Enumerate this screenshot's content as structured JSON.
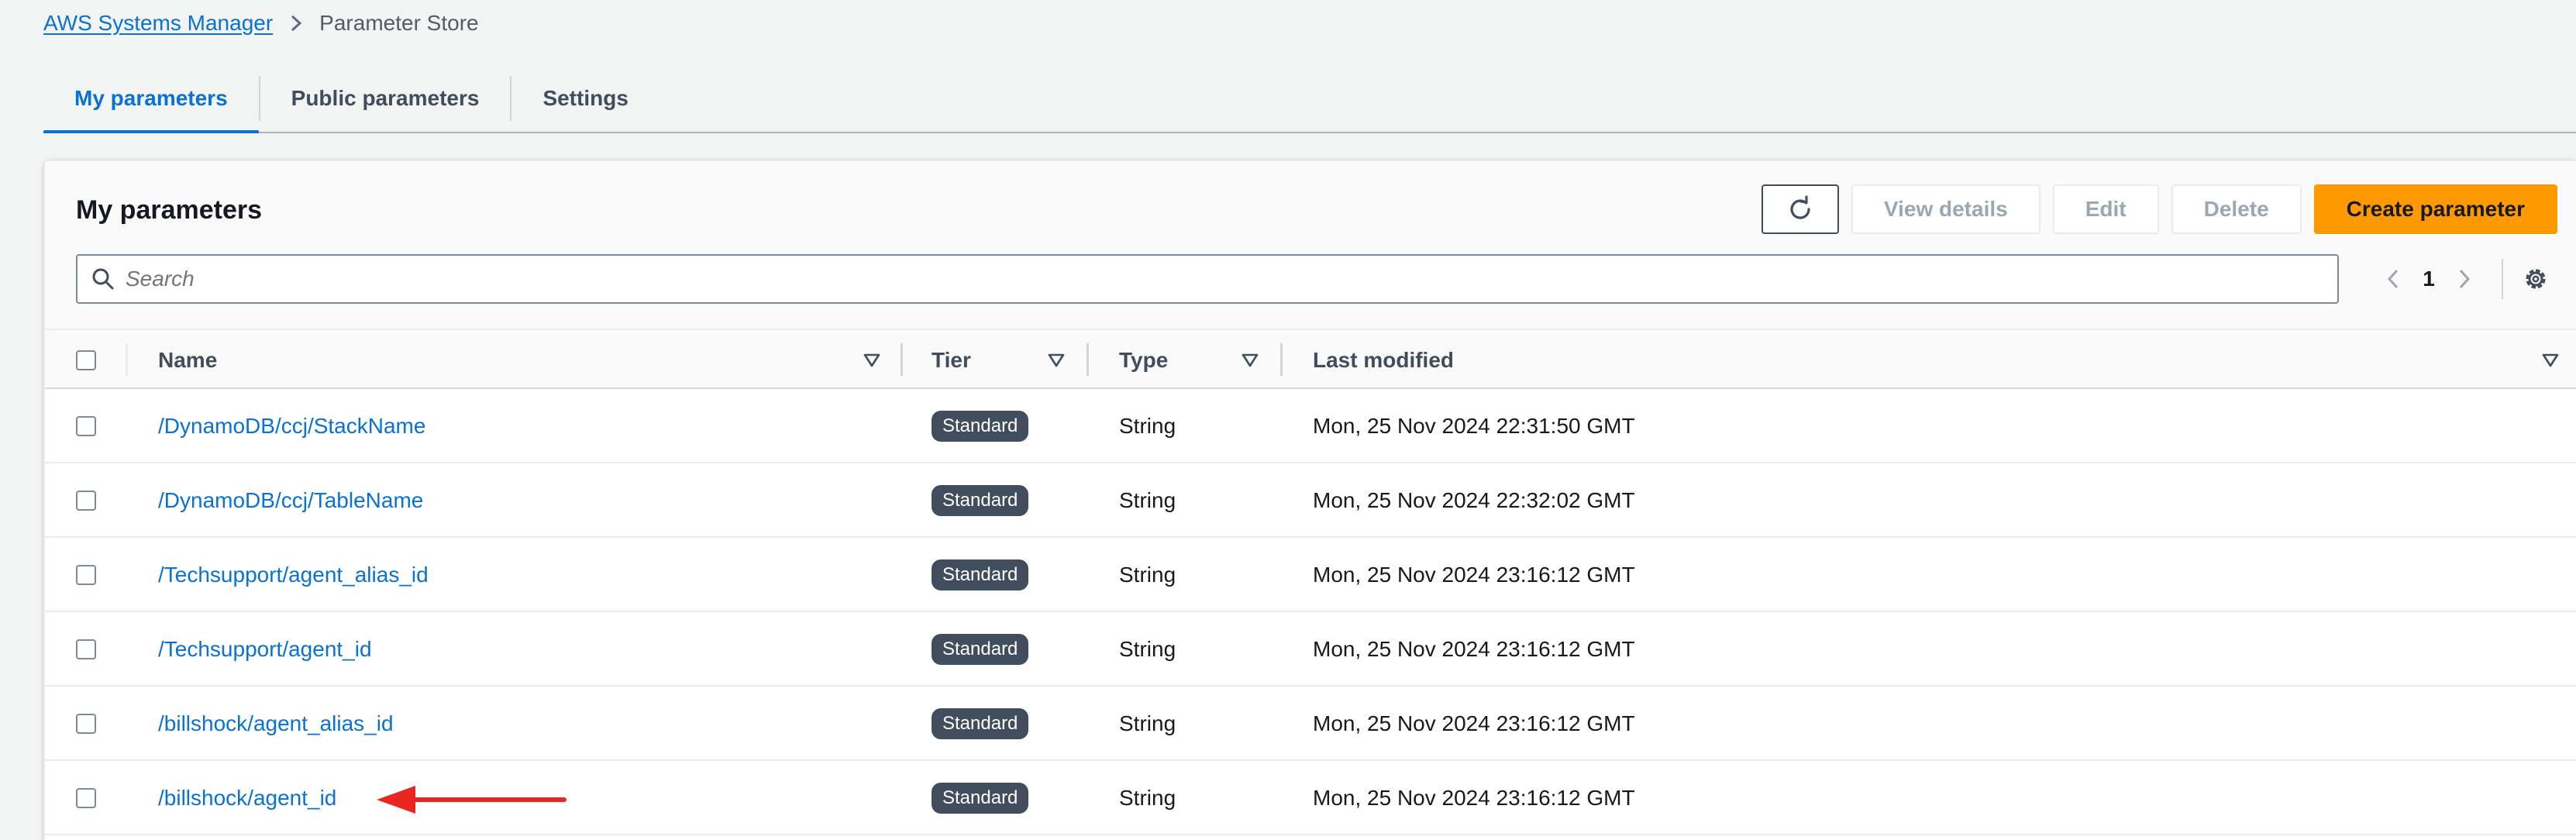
{
  "breadcrumb": {
    "root": "AWS Systems Manager",
    "current": "Parameter Store"
  },
  "tabs": [
    {
      "label": "My parameters",
      "active": true
    },
    {
      "label": "Public parameters",
      "active": false
    },
    {
      "label": "Settings",
      "active": false
    }
  ],
  "panel": {
    "title": "My parameters",
    "actions": {
      "refresh_icon": "refresh-icon",
      "view_details": "View details",
      "edit": "Edit",
      "delete": "Delete",
      "create": "Create parameter"
    },
    "search_placeholder": "Search",
    "pagination": {
      "page": "1"
    }
  },
  "table": {
    "columns": {
      "name": "Name",
      "tier": "Tier",
      "type": "Type",
      "last_modified": "Last modified"
    },
    "rows": [
      {
        "name": "/DynamoDB/ccj/StackName",
        "tier": "Standard",
        "type": "String",
        "last_modified": "Mon, 25 Nov 2024 22:31:50 GMT"
      },
      {
        "name": "/DynamoDB/ccj/TableName",
        "tier": "Standard",
        "type": "String",
        "last_modified": "Mon, 25 Nov 2024 22:32:02 GMT"
      },
      {
        "name": "/Techsupport/agent_alias_id",
        "tier": "Standard",
        "type": "String",
        "last_modified": "Mon, 25 Nov 2024 23:16:12 GMT"
      },
      {
        "name": "/Techsupport/agent_id",
        "tier": "Standard",
        "type": "String",
        "last_modified": "Mon, 25 Nov 2024 23:16:12 GMT"
      },
      {
        "name": "/billshock/agent_alias_id",
        "tier": "Standard",
        "type": "String",
        "last_modified": "Mon, 25 Nov 2024 23:16:12 GMT"
      },
      {
        "name": "/billshock/agent_id",
        "tier": "Standard",
        "type": "String",
        "last_modified": "Mon, 25 Nov 2024 23:16:12 GMT"
      }
    ]
  },
  "colors": {
    "link": "#0972d3",
    "primary_button": "#ff9900",
    "badge": "#414d5c",
    "annotation_arrow": "#e8261f"
  }
}
